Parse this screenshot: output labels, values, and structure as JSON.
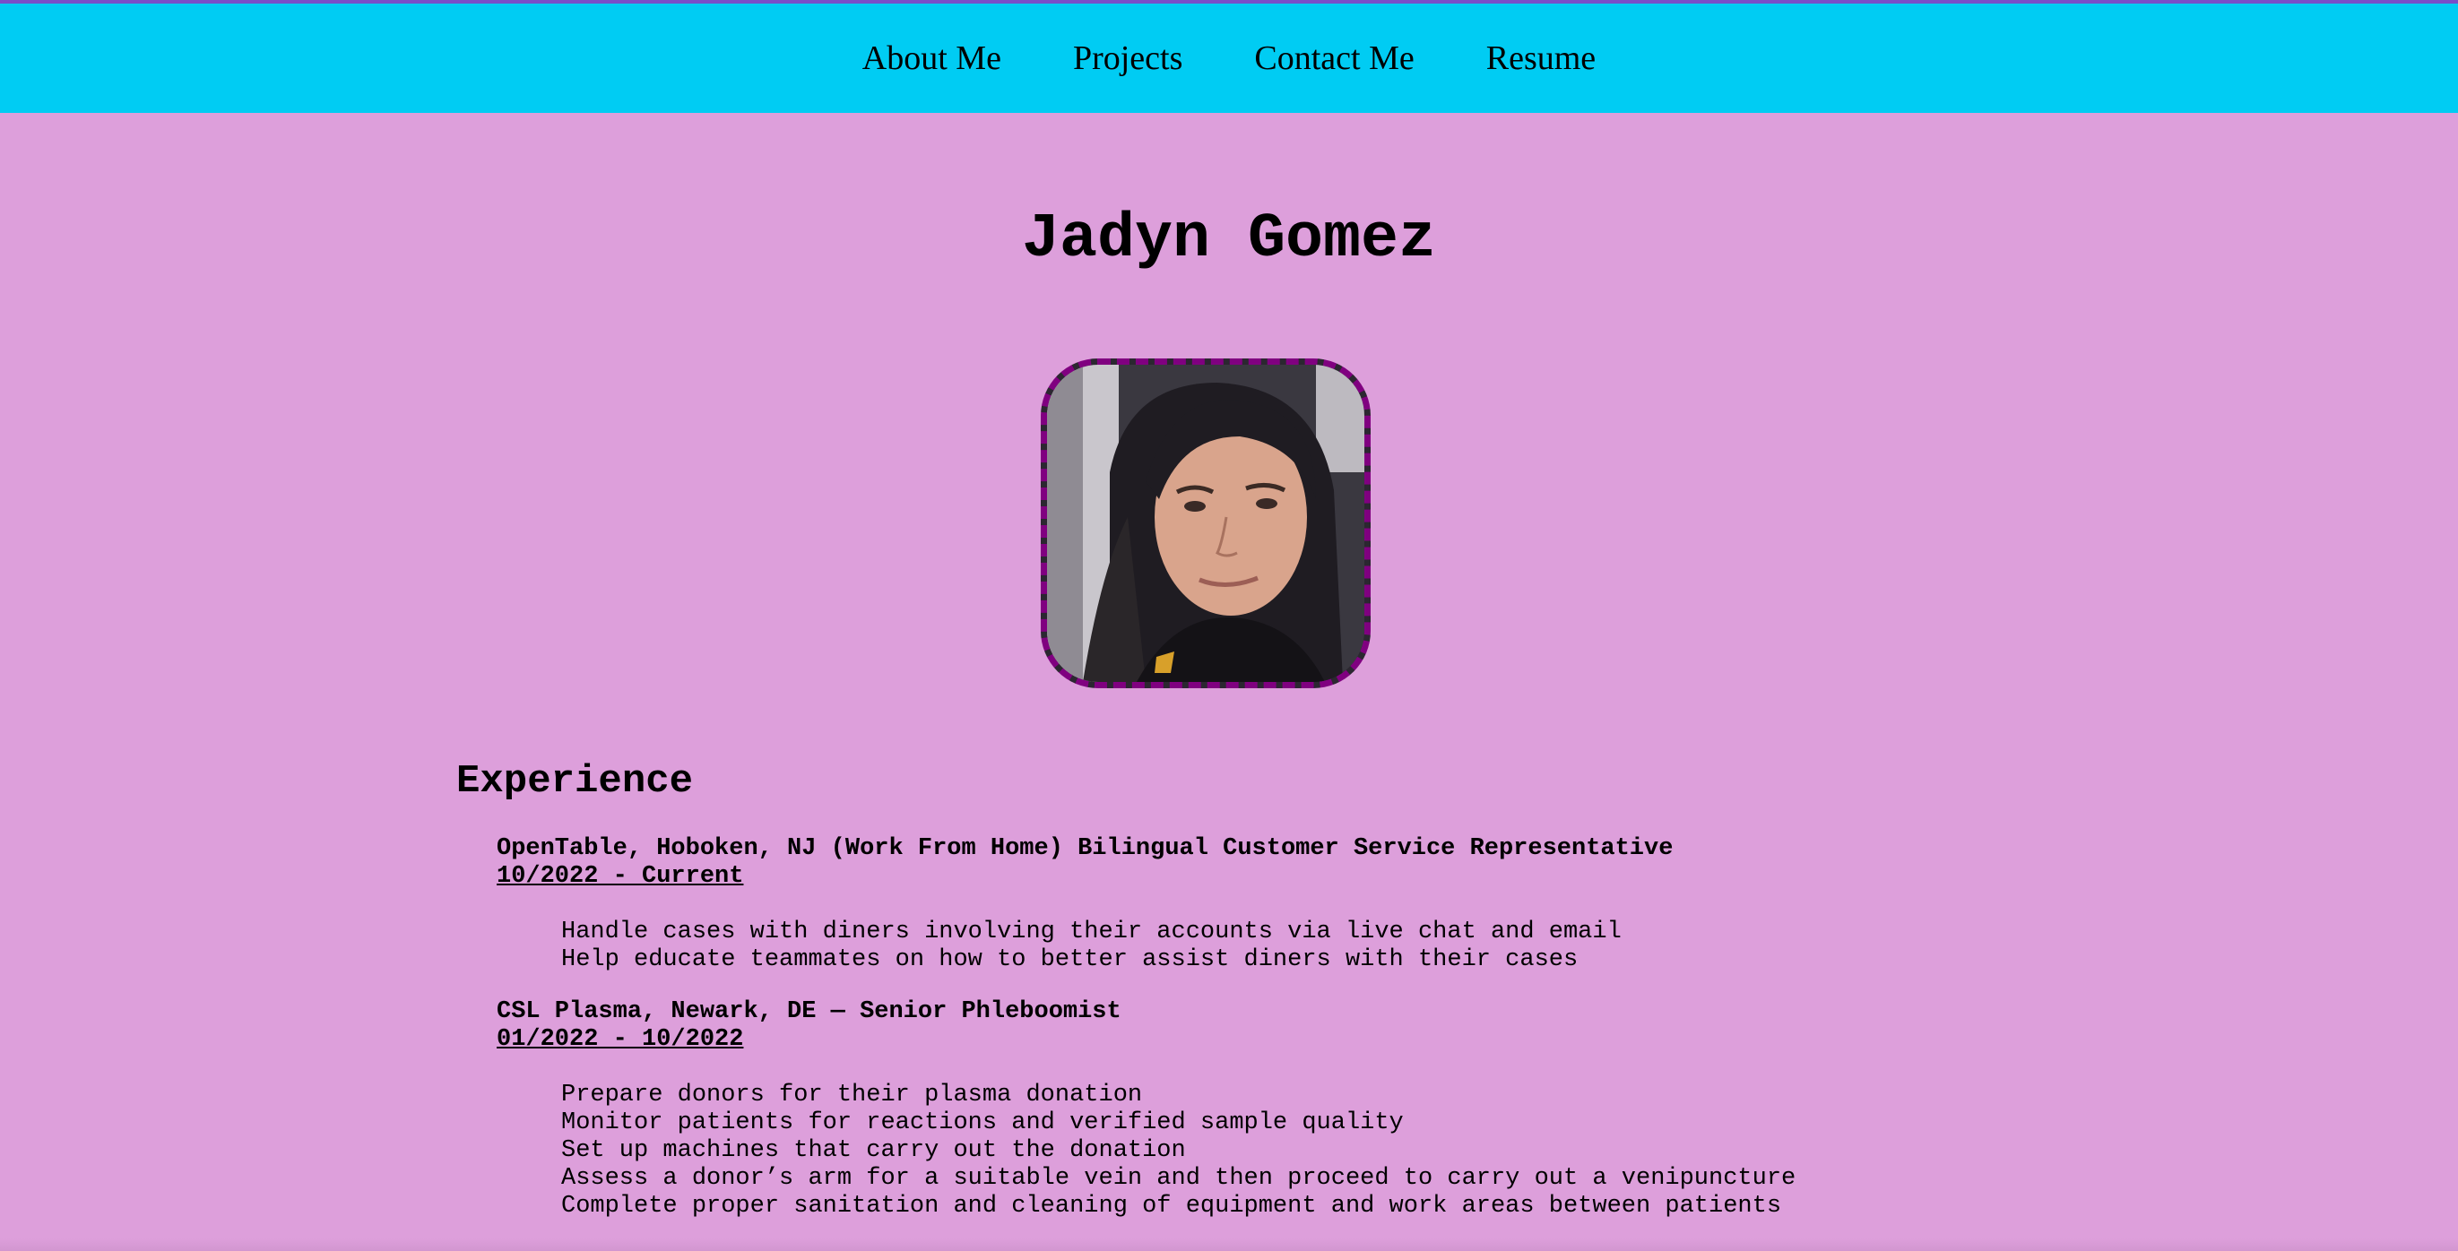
{
  "nav": {
    "items": [
      {
        "label": "About Me"
      },
      {
        "label": "Projects"
      },
      {
        "label": "Contact Me"
      },
      {
        "label": "Resume"
      }
    ]
  },
  "colors": {
    "page_background": "#dd9fdb",
    "nav_background": "#00ccf3",
    "avatar_border": "#800080"
  },
  "header": {
    "name": "Jadyn Gomez"
  },
  "experience": {
    "heading": "Experience",
    "jobs": [
      {
        "title": "OpenTable, Hoboken, NJ (Work From Home) Bilingual Customer Service Representative",
        "dates": "10/2022 - Current",
        "duties": [
          "Handle cases with diners involving their accounts via live chat and email",
          "Help educate teammates on how to better assist diners with their cases"
        ]
      },
      {
        "title": "CSL Plasma, Newark, DE — Senior Phleboomist",
        "dates": "01/2022 - 10/2022",
        "duties": [
          "Prepare donors for their plasma donation",
          "Monitor patients for reactions and verified sample quality",
          "Set up machines that carry out the donation",
          "Assess a donor’s arm for a suitable vein and then proceed to carry out a venipuncture",
          "Complete proper sanitation and cleaning of equipment and work areas between patients"
        ]
      }
    ]
  }
}
